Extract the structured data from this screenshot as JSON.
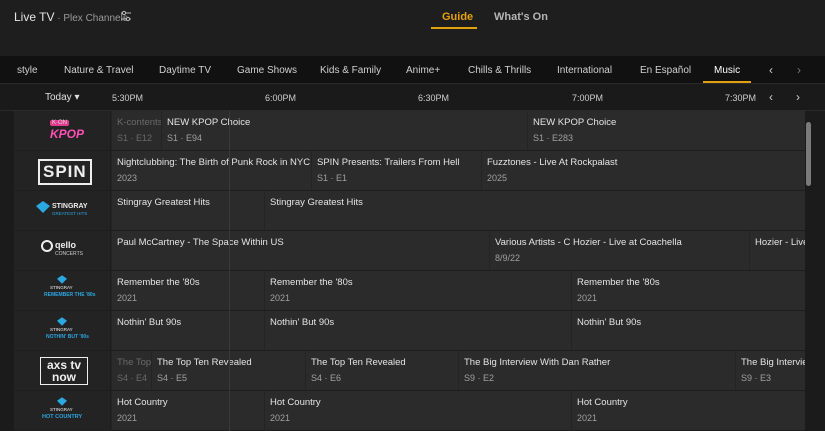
{
  "app": {
    "title": "Live TV",
    "subtitle": " · Plex Channels"
  },
  "top_tabs": {
    "guide": "Guide",
    "whats_on": "What's On"
  },
  "categories": [
    "style",
    "Nature & Travel",
    "Daytime TV",
    "Game Shows",
    "Kids & Family",
    "Anime+",
    "Chills & Thrills",
    "International",
    "En Español",
    "Music"
  ],
  "timeline": {
    "today": "Today ▾",
    "times": [
      "5:30PM",
      "6:00PM",
      "6:30PM",
      "7:00PM",
      "7:30PM"
    ]
  },
  "channels": [
    {
      "logo": "KPOP",
      "logo_small": "K·ON",
      "programs": [
        {
          "title": "K-contents",
          "sub": "S1 · E12",
          "past": true
        },
        {
          "title": "NEW KPOP Choice",
          "sub": "S1 · E94",
          "past": false
        },
        {
          "title": "NEW KPOP Choice",
          "sub": "S1 · E283",
          "past": false
        }
      ]
    },
    {
      "logo": "SPIN",
      "programs": [
        {
          "title": "Nightclubbing: The Birth of Punk Rock in NYC",
          "sub": "2023",
          "past": false
        },
        {
          "title": "SPIN Presents: Trailers From Hell",
          "sub": "S1 · E1",
          "past": false
        },
        {
          "title": "Fuzztones - Live At Rockpalast",
          "sub": "2025",
          "past": false
        }
      ]
    },
    {
      "logo": "STINGRAY",
      "logo_small": "GREATEST HITS",
      "programs": [
        {
          "title": "Stingray Greatest Hits",
          "sub": "",
          "past": false
        },
        {
          "title": "Stingray Greatest Hits",
          "sub": "",
          "past": false
        }
      ]
    },
    {
      "logo": "qello",
      "logo_small": "CONCERTS",
      "programs": [
        {
          "title": "Paul McCartney - The Space Within US",
          "sub": "",
          "past": false
        },
        {
          "title": "Various Artists - C Hozier - Live at Coachella",
          "sub": "8/9/22",
          "past": false
        },
        {
          "title": "Hozier - Live",
          "sub": "",
          "past": false
        }
      ]
    },
    {
      "logo": "STINGRAY",
      "logo_small": "REMEMBER THE '80s",
      "programs": [
        {
          "title": "Remember the '80s",
          "sub": "2021",
          "past": false
        },
        {
          "title": "Remember the '80s",
          "sub": "2021",
          "past": false
        },
        {
          "title": "Remember the '80s",
          "sub": "2021",
          "past": false
        }
      ]
    },
    {
      "logo": "STINGRAY",
      "logo_small": "NOTHIN' BUT '90s",
      "programs": [
        {
          "title": "Nothin' But 90s",
          "sub": "",
          "past": false
        },
        {
          "title": "Nothin' But 90s",
          "sub": "",
          "past": false
        },
        {
          "title": "Nothin' But 90s",
          "sub": "",
          "past": false
        }
      ]
    },
    {
      "logo": "axs tv now",
      "programs": [
        {
          "title": "The Top",
          "sub": "S4 · E4",
          "past": true
        },
        {
          "title": "The Top Ten Revealed",
          "sub": "S4 · E5",
          "past": false
        },
        {
          "title": "The Top Ten Revealed",
          "sub": "S4 · E6",
          "past": false
        },
        {
          "title": "The Big Interview With Dan Rather",
          "sub": "S9 · E2",
          "past": false
        },
        {
          "title": "The Big Intervie",
          "sub": "S9 · E3",
          "past": false
        }
      ]
    },
    {
      "logo": "STINGRAY",
      "logo_small": "HOT COUNTRY",
      "programs": [
        {
          "title": "Hot Country",
          "sub": "2021",
          "past": false
        },
        {
          "title": "Hot Country",
          "sub": "2021",
          "past": false
        },
        {
          "title": "Hot Country",
          "sub": "2021",
          "past": false
        }
      ]
    }
  ],
  "colors": {
    "accent": "#e5a00d",
    "background": "#1b1b1b",
    "cell": "#2b2b2b"
  }
}
